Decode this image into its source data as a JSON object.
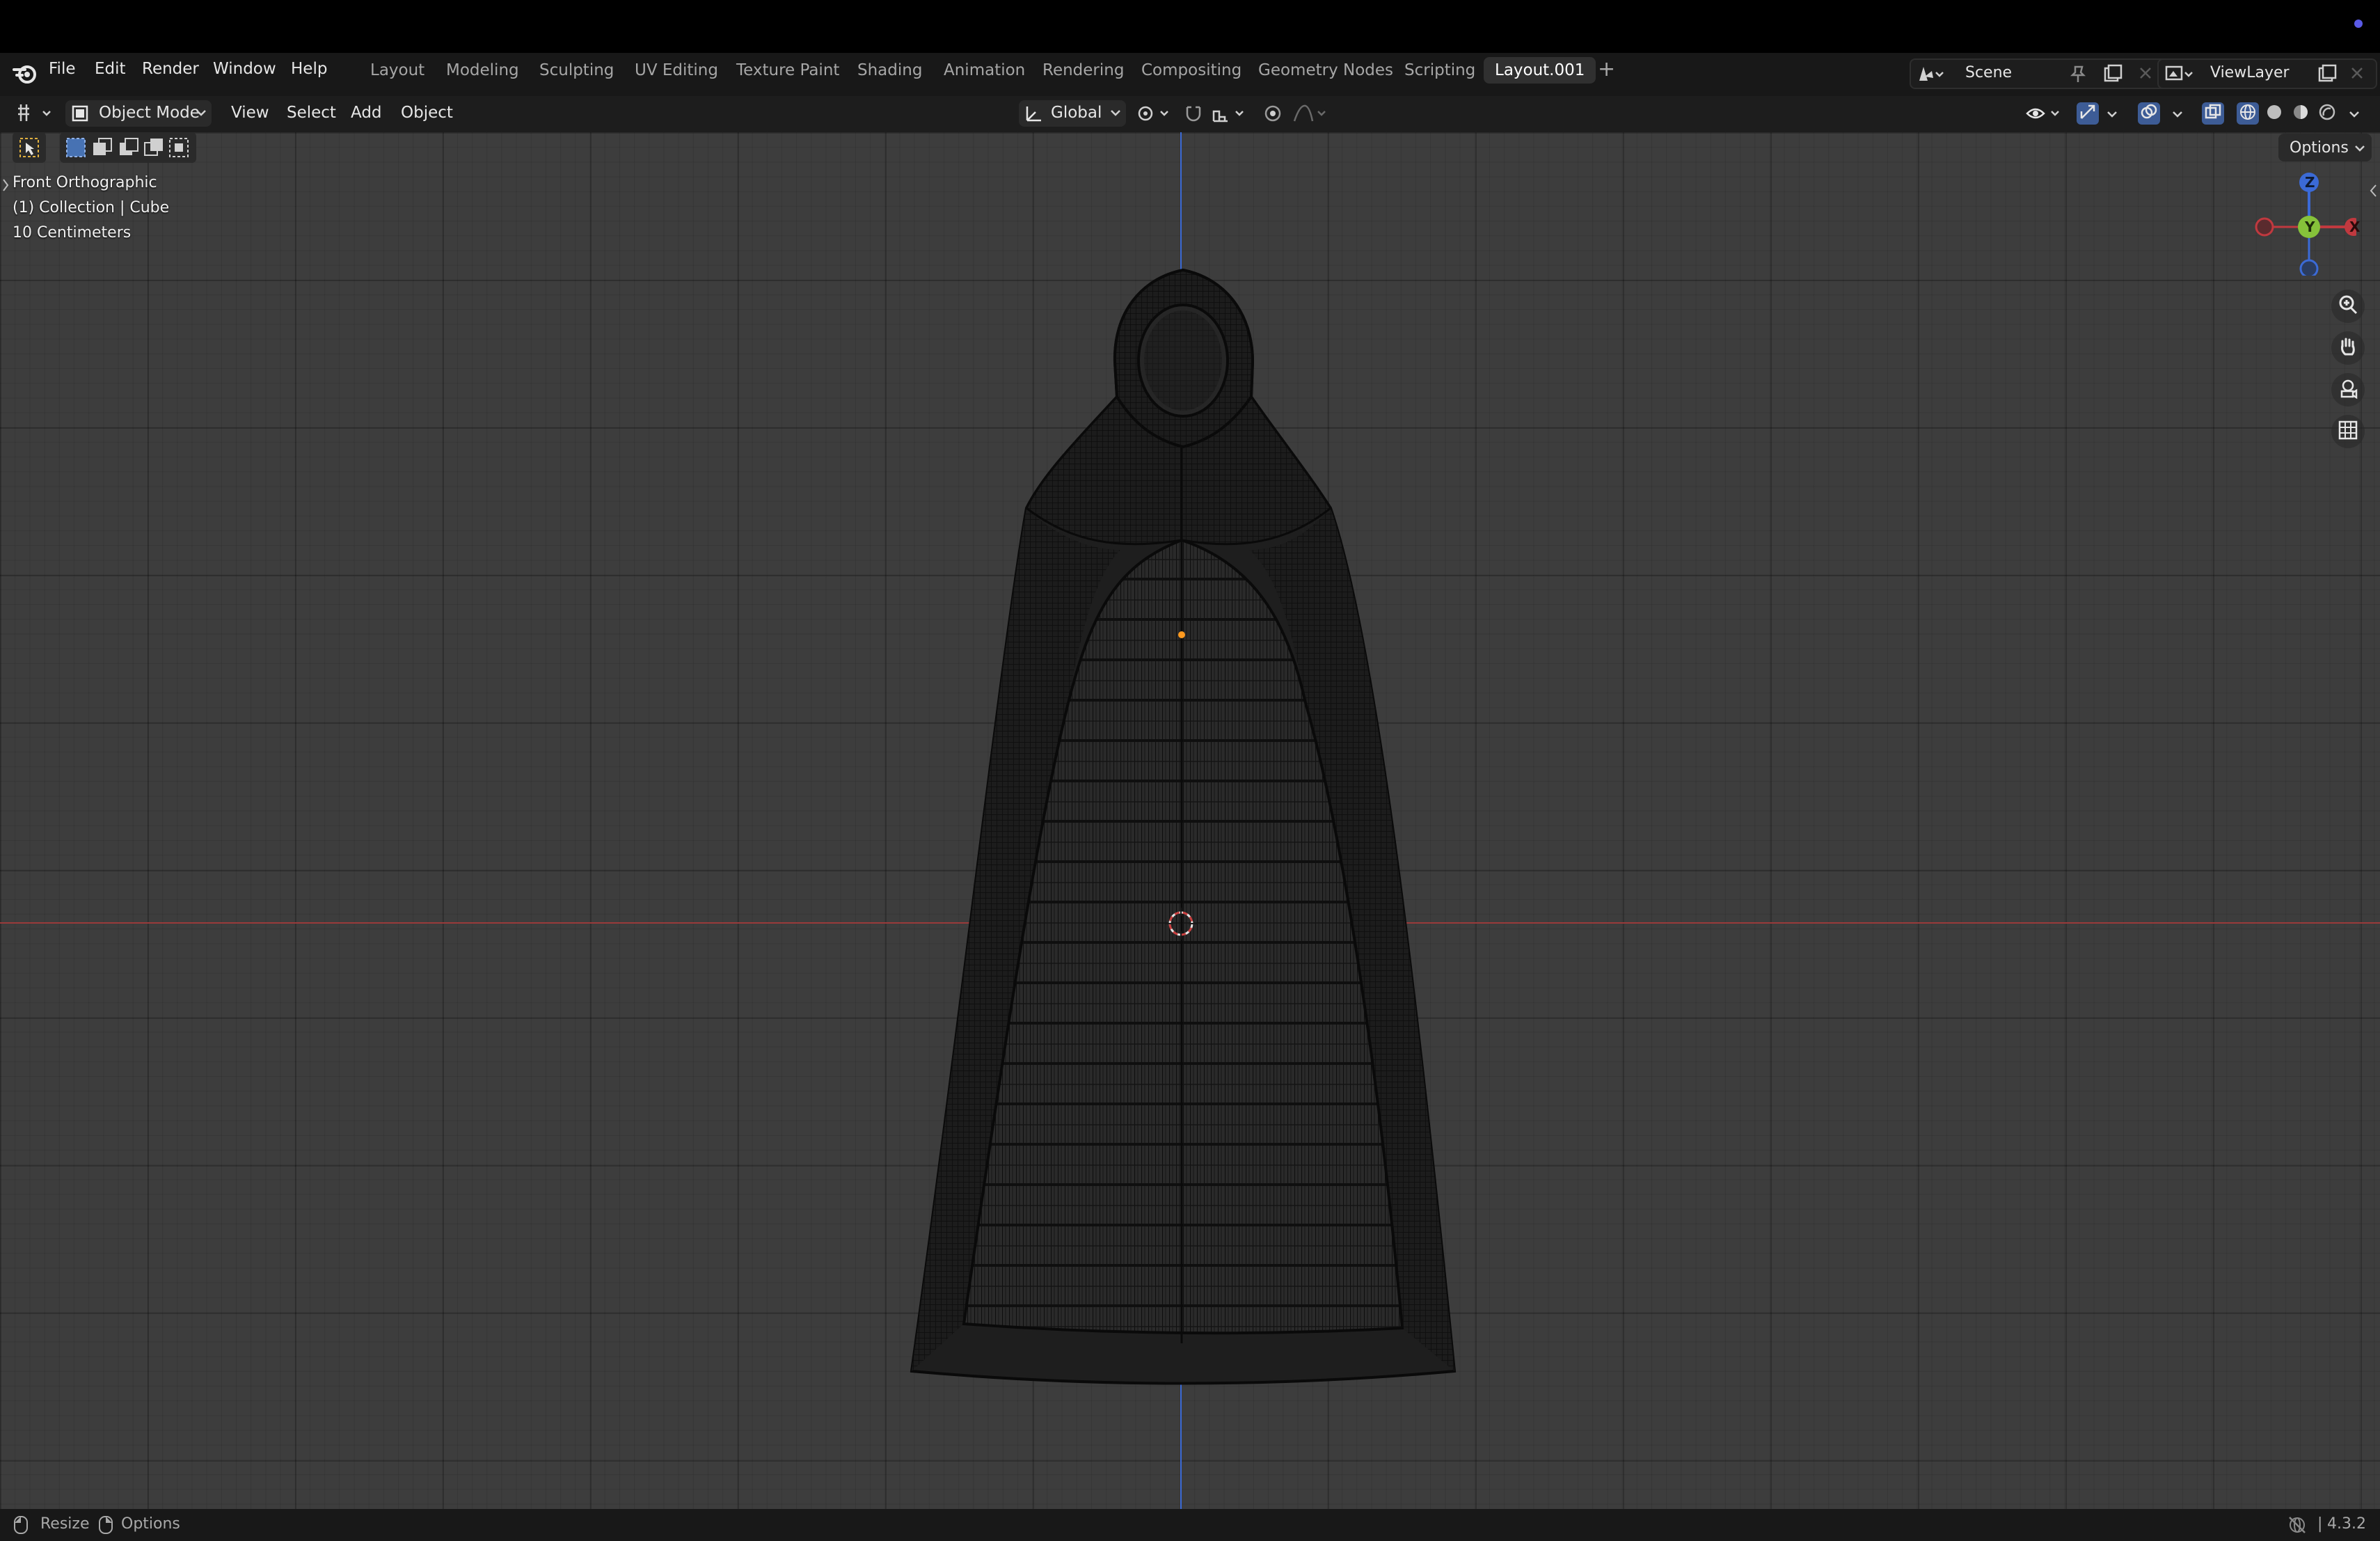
{
  "top_menu": {
    "items": [
      "File",
      "Edit",
      "Render",
      "Window",
      "Help"
    ]
  },
  "workspaces": {
    "tabs": [
      "Layout",
      "Modeling",
      "Sculpting",
      "UV Editing",
      "Texture Paint",
      "Shading",
      "Animation",
      "Rendering",
      "Compositing",
      "Geometry Nodes",
      "Scripting",
      "Layout.001"
    ],
    "active": "Layout.001",
    "add_symbol": "+"
  },
  "scene_selector": {
    "value": "Scene"
  },
  "viewlayer_selector": {
    "value": "ViewLayer"
  },
  "header": {
    "mode": "Object Mode",
    "menus": [
      "View",
      "Select",
      "Add",
      "Object"
    ],
    "transform_orientation": "Global",
    "options_label": "Options"
  },
  "viewport": {
    "view_name": "Front Orthographic",
    "collection_info": "(1) Collection | Cube",
    "scale_info": "10 Centimeters",
    "gizmo": {
      "z_label": "Z",
      "y_label": "Y",
      "x_label": "X"
    },
    "object": "hooded cloak wireframe mesh",
    "colors": {
      "x_axis": "#b34040",
      "z_axis": "#3b6ad6",
      "wire": "#141414"
    }
  },
  "status_bar": {
    "resize_label": "Resize",
    "options_label": "Options",
    "version": "4.3.2"
  }
}
